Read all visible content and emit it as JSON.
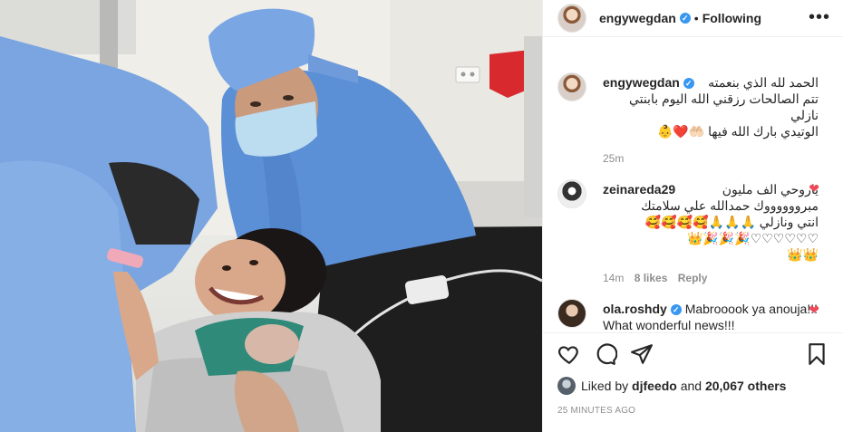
{
  "post": {
    "username": "engywegdan",
    "verified_mark": "✓",
    "separator": "•",
    "follow_status": "Following",
    "more_label": "•••",
    "caption_line1": "الحمد لله الذي بنعمته",
    "caption_line2": "تتم الصالحات رزقني الله اليوم بابنتي نازلي",
    "caption_line3": "الوتيدي بارك الله فيها 🤲🏻❤️👶",
    "caption_time": "25m"
  },
  "comments": [
    {
      "username": "zeinareda29",
      "line1": "ياروحي الف مليون",
      "line2": "مبرووووووك حمدالله علي سلامتك",
      "line3": "انتي ونازلي 🙏🙏🙏🥰🥰🥰🥰",
      "line4": "♡♡♡♡♡♡🎉🎉🎉👑",
      "line5": "👑👑",
      "time": "14m",
      "likes": "8 likes",
      "reply": "Reply"
    },
    {
      "username": "ola.roshdy",
      "text": "Mabrooook ya anouja!!! What wonderful news!!!"
    }
  ],
  "likes": {
    "prefix": "Liked by",
    "user": "djfeedo",
    "middle": "and",
    "count": "20,067 others"
  },
  "timestamp": "25 MINUTES AGO",
  "icons": {
    "like": "heart-icon",
    "comment": "comment-icon",
    "share": "share-icon",
    "save": "bookmark-icon",
    "comment_like": "heart-filled-icon"
  },
  "colors": {
    "verified": "#3897f0",
    "liked_heart": "#ed4956",
    "muted_text": "#8e8e8e"
  }
}
